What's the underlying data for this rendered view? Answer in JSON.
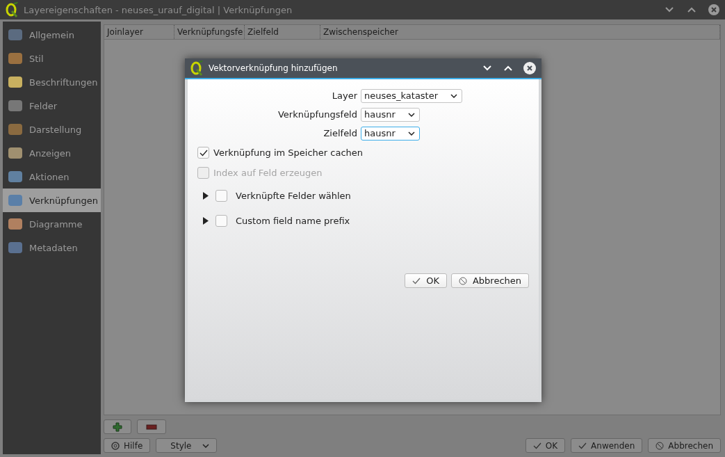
{
  "window": {
    "title": "Layereigenschaften - neuses_urauf_digital | Verknüpfungen"
  },
  "sidebar": {
    "items": [
      {
        "label": "Allgemein",
        "selected": false
      },
      {
        "label": "Stil",
        "selected": false
      },
      {
        "label": "Beschriftungen",
        "selected": false
      },
      {
        "label": "Felder",
        "selected": false
      },
      {
        "label": "Darstellung",
        "selected": false
      },
      {
        "label": "Anzeigen",
        "selected": false
      },
      {
        "label": "Aktionen",
        "selected": false
      },
      {
        "label": "Verknüpfungen",
        "selected": true
      },
      {
        "label": "Diagramme",
        "selected": false
      },
      {
        "label": "Metadaten",
        "selected": false
      }
    ]
  },
  "table": {
    "columns": [
      "Joinlayer",
      "Verknüpfungsfe",
      "Zielfeld",
      "Zwischenspeicher"
    ]
  },
  "footer": {
    "left_buttons": [
      {
        "label": "Hilfe",
        "kind": "help"
      },
      {
        "label": "Style",
        "kind": "menu"
      }
    ],
    "right_buttons": [
      {
        "label": "OK",
        "kind": "check"
      },
      {
        "label": "Anwenden",
        "kind": "check"
      },
      {
        "label": "Abbrechen",
        "kind": "cancel"
      }
    ]
  },
  "dialog": {
    "title": "Vektorverknüpfung hinzufügen",
    "fields": [
      {
        "label": "Layer",
        "value": "neuses_kataster",
        "focused": false
      },
      {
        "label": "Verknüpfungsfeld",
        "value": "hausnr",
        "focused": false
      },
      {
        "label": "Zielfeld",
        "value": "hausnr",
        "focused": true
      }
    ],
    "options": [
      {
        "kind": "checkbox",
        "label": "Verknüpfung im Speicher cachen",
        "checked": true,
        "disabled": false
      },
      {
        "kind": "checkbox",
        "label": "Index auf Feld erzeugen",
        "checked": false,
        "disabled": true
      },
      {
        "kind": "group",
        "label": "Verknüpfte Felder wählen",
        "checked": false,
        "disabled": false
      },
      {
        "kind": "group",
        "label": "Custom field name prefix",
        "checked": false,
        "disabled": false
      }
    ],
    "buttons": [
      {
        "label": "OK",
        "kind": "check"
      },
      {
        "label": "Abbrechen",
        "kind": "cancel"
      }
    ]
  }
}
